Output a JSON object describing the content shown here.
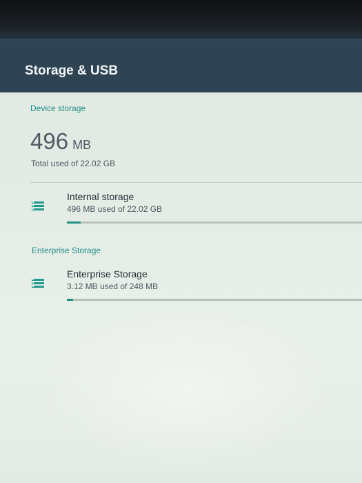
{
  "header": {
    "title": "Storage & USB"
  },
  "device_storage": {
    "section_label": "Device storage",
    "used_value": "496",
    "used_unit": "MB",
    "total_used_text": "Total used of 22.02 GB"
  },
  "storage_items": [
    {
      "title": "Internal storage",
      "summary": "496 MB used of 22.02 GB",
      "used_fraction": 0.047
    }
  ],
  "enterprise": {
    "section_label": "Enterprise Storage",
    "items": [
      {
        "title": "Enterprise Storage",
        "summary": "3.12 MB used of 248 MB",
        "used_fraction": 0.02
      }
    ]
  },
  "colors": {
    "accent": "#1f8f85",
    "app_bar": "#2f4553"
  },
  "icons": {
    "storage": "storage-icon"
  }
}
